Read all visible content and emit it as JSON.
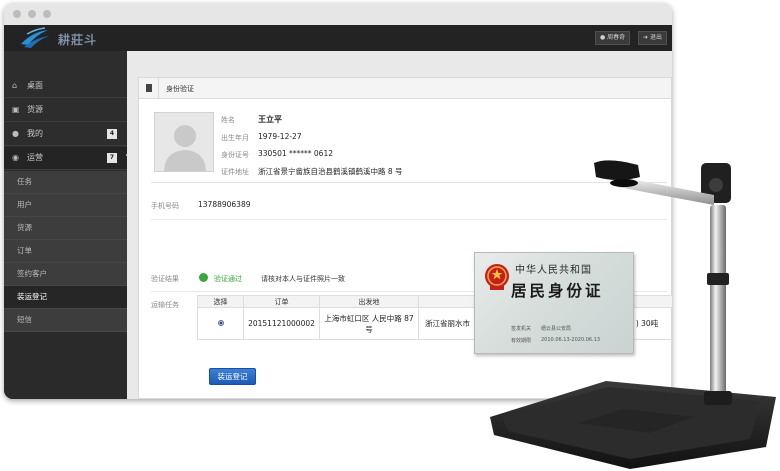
{
  "header": {
    "logo_text": "耕莊斗",
    "buttons": [
      {
        "icon": "user-icon",
        "label": "周春奇"
      },
      {
        "icon": "logout-icon",
        "label": "退出"
      }
    ]
  },
  "sidebar": {
    "items": [
      {
        "icon": "home-icon",
        "label": "桌面"
      },
      {
        "icon": "shopping-cart-icon",
        "label": "货源"
      },
      {
        "icon": "user-icon",
        "label": "我的",
        "badge": "4"
      },
      {
        "icon": "globe-icon",
        "label": "运营",
        "badge": "7"
      }
    ],
    "sub_items": [
      "任务",
      "用户",
      "货源",
      "订单",
      "签约客户",
      "装运登记",
      "短信"
    ],
    "current_sub_item": "装运登记"
  },
  "panel": {
    "title": "身份验证"
  },
  "profile": {
    "name_label": "姓名",
    "name": "王立平",
    "birth_label": "出生年月",
    "birth": "1979-12-27",
    "id_label": "身份证号",
    "id_number": "330501 ****** 0612",
    "address_label": "证件地址",
    "address": "浙江省景宁畲族自治县鹤溪镇鹤溪中路 8 号"
  },
  "phone": {
    "label": "手机号码",
    "value": "13788906389"
  },
  "verification": {
    "label": "验证结果",
    "status": "验证通过",
    "note": "请核对本人与证件照片一致",
    "status_color": "#39a83a"
  },
  "tasks": {
    "label": "运输任务",
    "columns": [
      "选择",
      "订单",
      "出发地",
      "",
      "",
      ""
    ],
    "rows": [
      {
        "order": "20151121000002",
        "origin": "上海市虹口区 人民中路 87号",
        "destination": "浙江省丽水市",
        "extra": "",
        "qty": ") 30吨",
        "selected": true
      }
    ]
  },
  "actions": {
    "submit_label": "装运登记",
    "primary_color": "#1c5bb5"
  },
  "id_card": {
    "country": "中华人民共和国",
    "title": "居民身份证",
    "authority_label": "签发机关",
    "authority": "缙云县公安局",
    "validity_label": "有效期限",
    "validity": "2010.06.13-2020.06.13"
  }
}
